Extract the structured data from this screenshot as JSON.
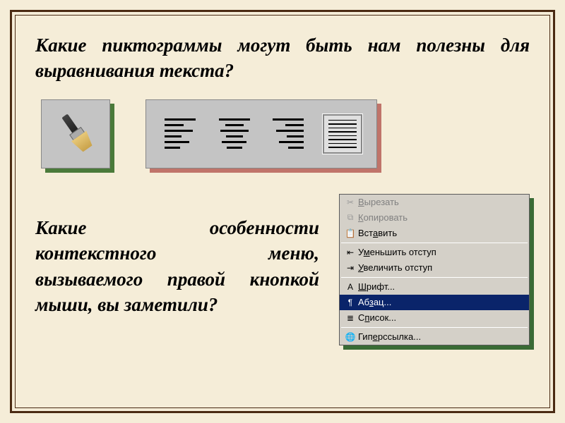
{
  "q1": "Какие пиктограммы могут быть нам полезны для выравнивания текста?",
  "q2": "Какие особенности контекстного меню, вызываемого правой кнопкой мыши, вы заметили?",
  "toolbar": {
    "brush": "format-painter",
    "align": [
      "align-left",
      "align-center",
      "align-right",
      "align-justify"
    ],
    "selected": "align-justify"
  },
  "context_menu": {
    "items": [
      {
        "icon": "cut-icon",
        "pre": "",
        "u": "В",
        "post": "ырезать",
        "enabled": false
      },
      {
        "icon": "copy-icon",
        "pre": "",
        "u": "К",
        "post": "опировать",
        "enabled": false
      },
      {
        "icon": "paste-icon",
        "pre": "Вст",
        "u": "а",
        "post": "вить",
        "enabled": true
      },
      {
        "sep": true
      },
      {
        "icon": "outdent-icon",
        "pre": "У",
        "u": "м",
        "post": "еньшить отступ",
        "enabled": true
      },
      {
        "icon": "indent-icon",
        "pre": "",
        "u": "У",
        "post": "величить отступ",
        "enabled": true
      },
      {
        "sep": true
      },
      {
        "icon": "font-icon",
        "pre": "",
        "u": "Ш",
        "post": "рифт...",
        "enabled": true
      },
      {
        "icon": "paragraph-icon",
        "pre": "Аб",
        "u": "з",
        "post": "ац...",
        "enabled": true,
        "selected": true
      },
      {
        "icon": "list-icon",
        "pre": "С",
        "u": "п",
        "post": "исок...",
        "enabled": true
      },
      {
        "sep": true
      },
      {
        "icon": "hyperlink-icon",
        "pre": "Гип",
        "u": "е",
        "post": "рссылка...",
        "enabled": true
      }
    ]
  }
}
